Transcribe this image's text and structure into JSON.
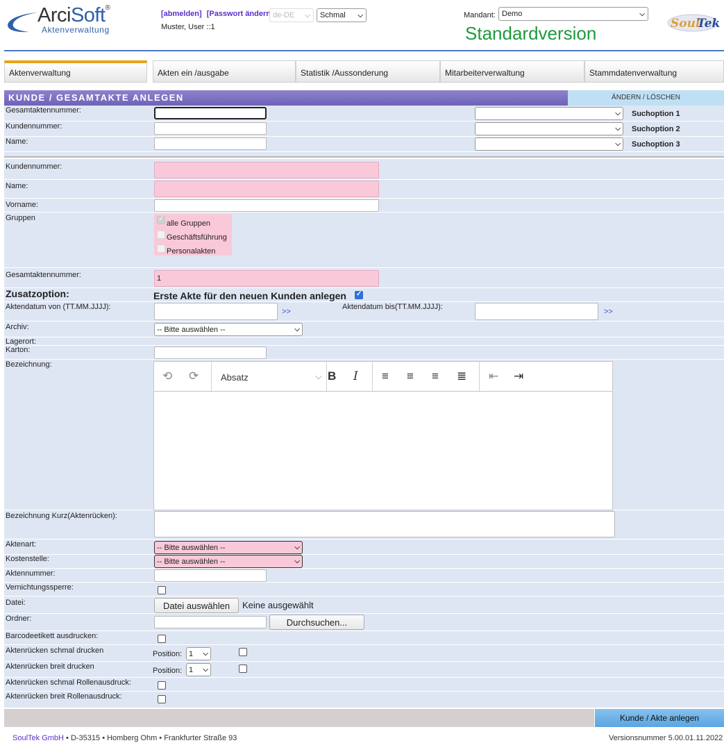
{
  "header": {
    "logo_name_1": "Arci",
    "logo_name_2": "Soft",
    "logo_reg": "®",
    "logo_sub": "Aktenverwaltung",
    "link_logout": "[abmelden]",
    "link_password": "[Passwort ändern]",
    "language_select": "de-DE",
    "width_select": "Schmal",
    "user_line": "Muster, User ::1",
    "mandant_label": "Mandant:",
    "mandant_value": "Demo",
    "version_title": "Standardversion",
    "brand_logo": "SoulTek"
  },
  "nav": {
    "tabs": [
      {
        "label": "Aktenverwaltung"
      },
      {
        "label": "Akten ein /ausgabe"
      },
      {
        "label": "Statistik /Aussonderung"
      },
      {
        "label": "Mitarbeiterverwaltung"
      },
      {
        "label": "Stammdatenverwaltung"
      }
    ]
  },
  "section": {
    "title": "KUNDE / GESAMTAKTE ANLEGEN",
    "change_delete": "ÄNDERN / LÖSCHEN"
  },
  "search": {
    "rows": [
      {
        "label": "Gesamtaktennummer:",
        "option": "Suchoption 1"
      },
      {
        "label": "Kundennummer:",
        "option": "Suchoption 2"
      },
      {
        "label": "Name:",
        "option": "Suchoption 3"
      }
    ]
  },
  "form": {
    "kundennummer_label": "Kundennummer:",
    "name_label": "Name:",
    "vorname_label": "Vorname:",
    "gruppen_label": "Gruppen",
    "groups": [
      {
        "label": "alle Gruppen",
        "checked": true
      },
      {
        "label": "Geschäftsführung",
        "checked": false
      },
      {
        "label": "Personalakten",
        "checked": false
      }
    ],
    "gesamtaktennummer_label": "Gesamtaktennummer:",
    "gesamtaktennummer_value": "1",
    "zusatz_label": "Zusatzoption:",
    "zusatz_text": "Erste Akte für den neuen Kunden anlegen",
    "aktendatum_von_label": "Aktendatum von (TT.MM.JJJJ):",
    "aktendatum_bis_label": "Aktendatum bis(TT.MM.JJJJ):",
    "arrows": ">>",
    "archiv_label": "Archiv:",
    "archiv_value": "-- Bitte auswählen --",
    "lagerort_label": "Lagerort:",
    "karton_label": "Karton:",
    "bezeichnung_label": "Bezeichnung:",
    "editor_paragraph": "Absatz",
    "bezeichnung_kurz_label": "Bezeichnung Kurz(Aktenrücken):",
    "aktenart_label": "Aktenart:",
    "aktenart_value": "-- Bitte auswählen --",
    "kostenstelle_label": "Kostenstelle:",
    "kostenstelle_value": "-- Bitte auswählen --",
    "aktennummer_label": "Aktennummer:",
    "vernichtung_label": "Vernichtungssperre:",
    "datei_label": "Datei:",
    "datei_button": "Datei auswählen",
    "datei_status": "Keine ausgewählt",
    "ordner_label": "Ordner:",
    "ordner_button": "Durchsuchen...",
    "barcode_label": "Barcodeetikett ausdrucken:",
    "schmal_label": "Aktenrücken schmal drucken",
    "breit_label": "Aktenrücken breit drucken",
    "position_label": "Position:",
    "position_value": "1",
    "schmal_rolle_label": "Aktenrücken schmal Rollenausdruck:",
    "breit_rolle_label": "Aktenrücken breit Rollenausdruck:"
  },
  "actions": {
    "submit": "Kunde / Akte anlegen"
  },
  "footer": {
    "brand": "SoulTek GmbH",
    "address": " • D-35315 • Homberg Ohm • Frankfurter Straße 93",
    "version": "Versionsnummer 5.00.01.11.2022"
  },
  "colors": {
    "accent_blue": "#4a76c2",
    "title_purple": "#6f62b8",
    "required_pink": "#f9c9da",
    "version_green": "#1e9a3c",
    "row_bg": "#dfe6f3",
    "submit_blue": "#5aa5e2"
  }
}
